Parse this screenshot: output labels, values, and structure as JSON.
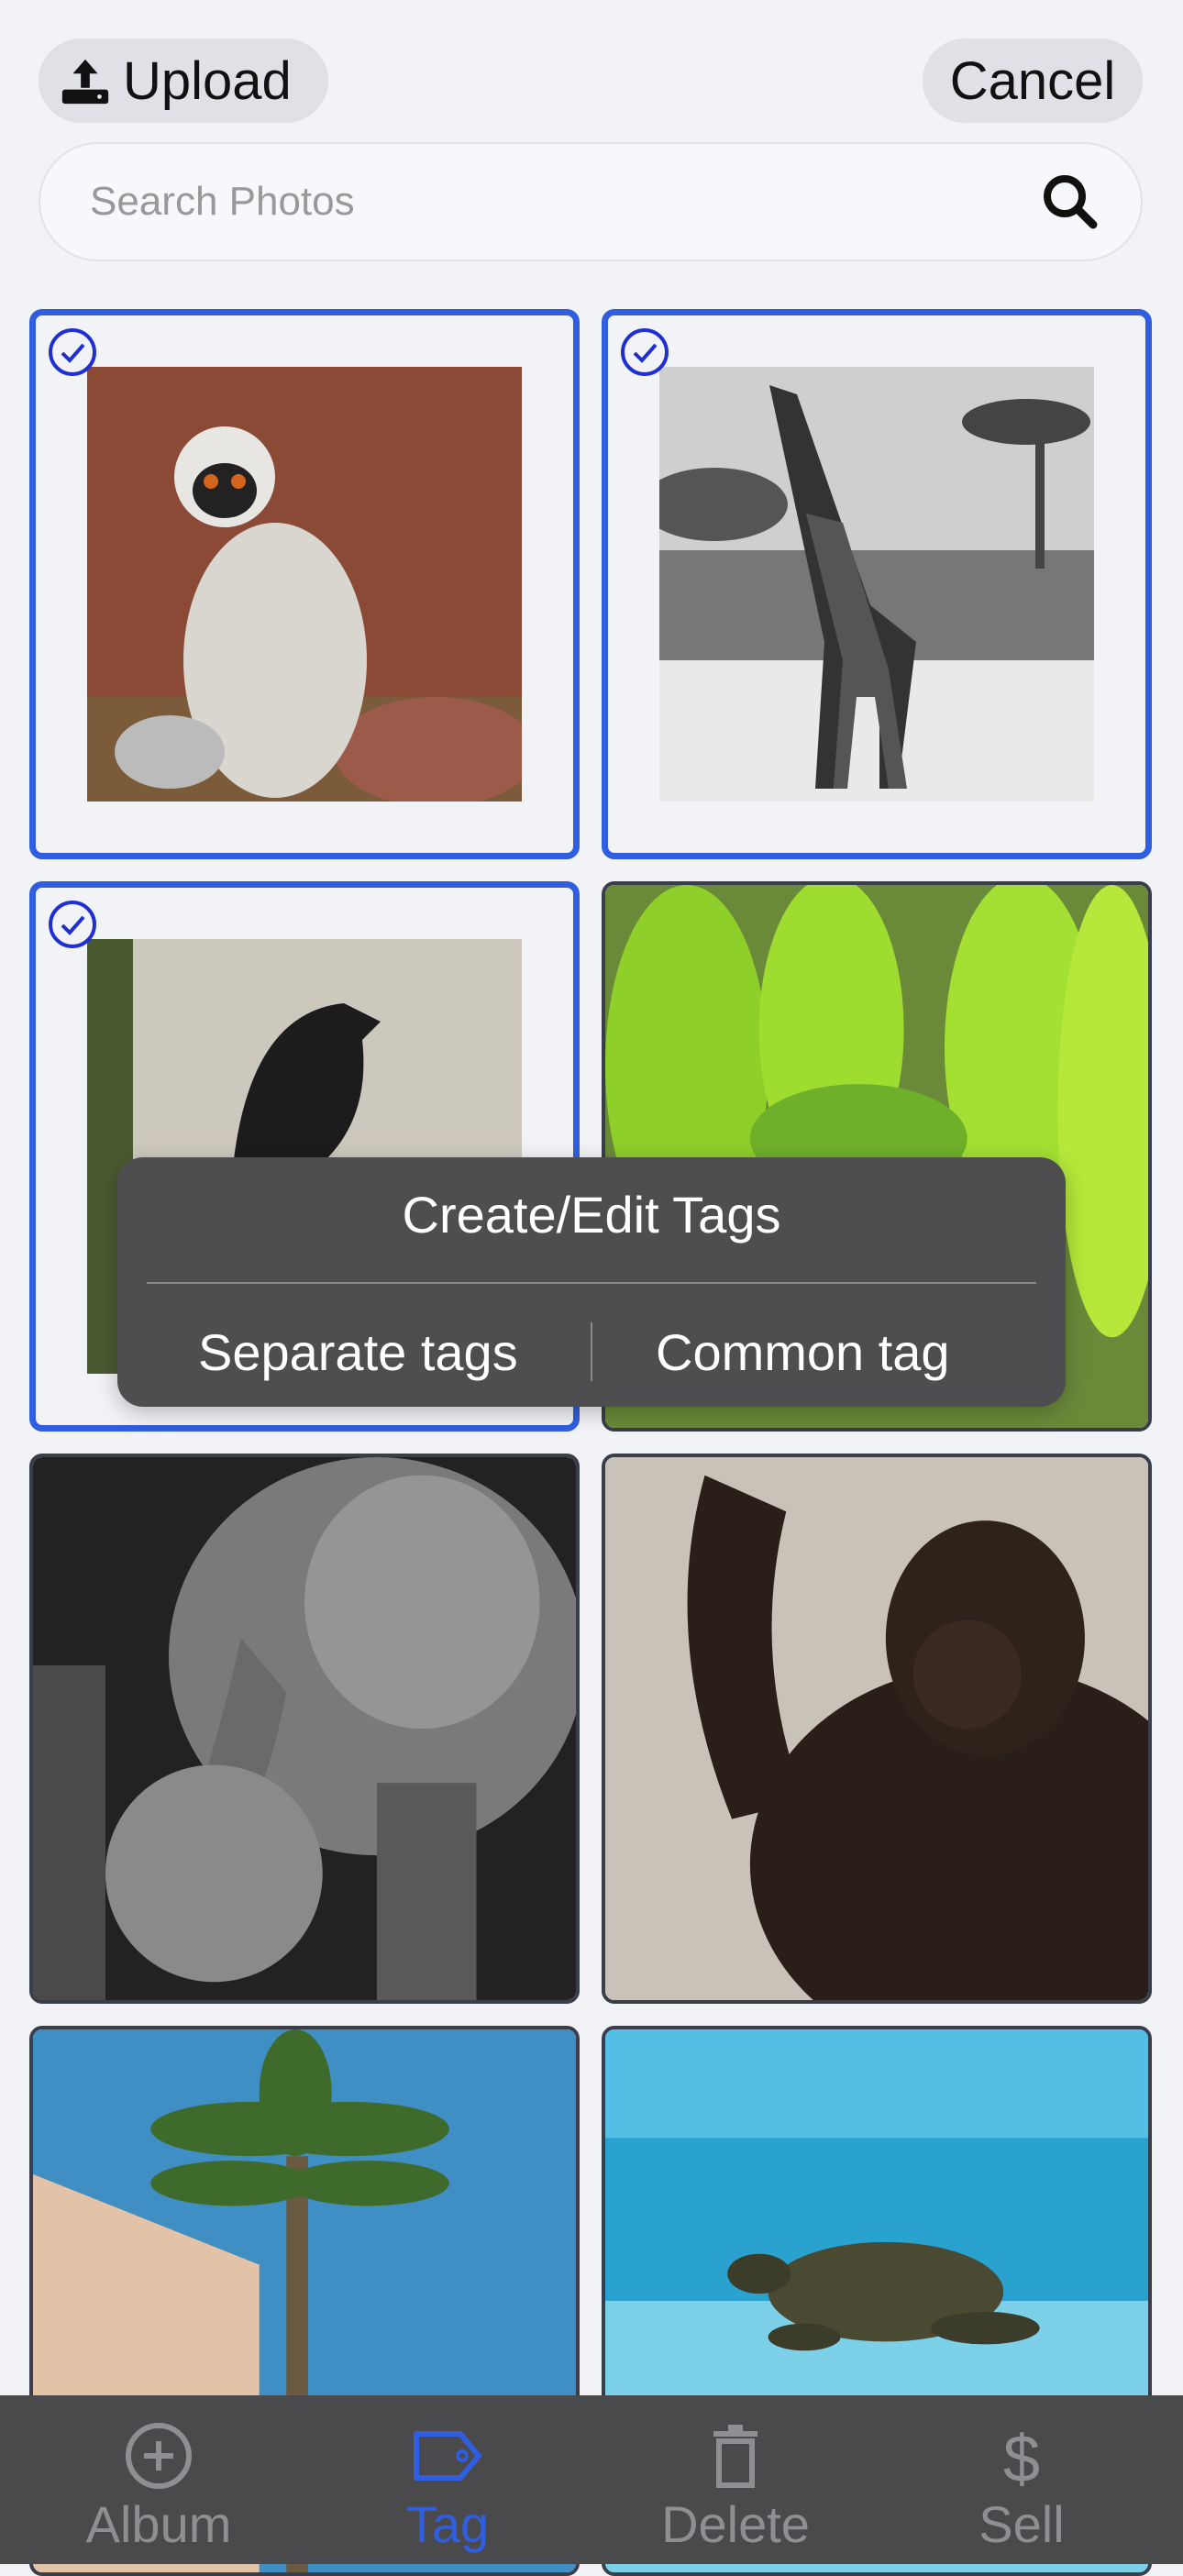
{
  "header": {
    "upload_label": "Upload",
    "cancel_label": "Cancel"
  },
  "search": {
    "placeholder": "Search Photos",
    "value": ""
  },
  "photos": [
    {
      "subject": "lemur",
      "selected": true
    },
    {
      "subject": "giraffes",
      "selected": true
    },
    {
      "subject": "bird",
      "selected": true
    },
    {
      "subject": "green snake",
      "selected": false
    },
    {
      "subject": "elephants",
      "selected": false
    },
    {
      "subject": "chimpanzee",
      "selected": false
    },
    {
      "subject": "palm tree",
      "selected": false
    },
    {
      "subject": "sea turtle",
      "selected": false
    }
  ],
  "popup": {
    "title": "Create/Edit Tags",
    "option_separate": "Separate tags",
    "option_common": "Common tag"
  },
  "tabbar": {
    "tabs": [
      {
        "label": "Album",
        "icon": "plus-circle-icon",
        "active": false
      },
      {
        "label": "Tag",
        "icon": "tag-icon",
        "active": true
      },
      {
        "label": "Delete",
        "icon": "trash-icon",
        "active": false
      },
      {
        "label": "Sell",
        "icon": "dollar-icon",
        "active": false
      }
    ]
  },
  "colors": {
    "accent": "#2f5ee0",
    "background": "#f2f3f7",
    "popup": "#4e4e50",
    "tabbar": "#4a4a4c"
  }
}
